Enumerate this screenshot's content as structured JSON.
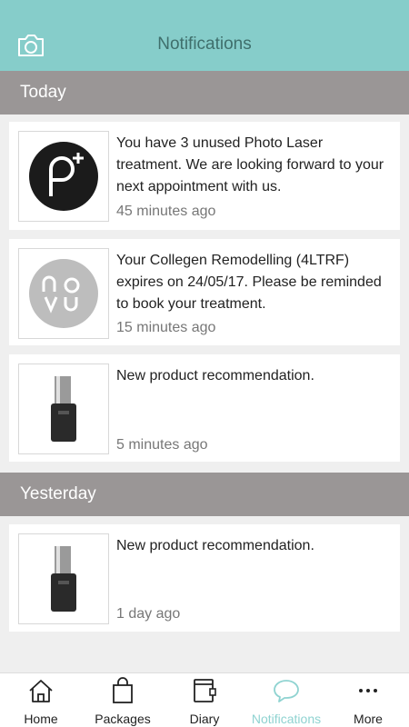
{
  "header": {
    "title": "Notifications",
    "camera_icon": "camera-icon"
  },
  "sections": [
    {
      "label": "Today"
    },
    {
      "label": "Yesterday"
    }
  ],
  "notifications": [
    {
      "thumbnail": "brand-logo-p-plus",
      "thumbnail_text": "p+",
      "message": "You have 3 unused Photo Laser treatment. We are looking forward to your next appointment with us.",
      "time": "45 minutes ago"
    },
    {
      "thumbnail": "brand-logo-novu",
      "thumbnail_text": "novu",
      "message": "Your Collegen Remodelling (4LTRF) expires on 24/05/17. Please be reminded to book your treatment.",
      "time": "15 minutes ago"
    },
    {
      "thumbnail": "product-bottle-image",
      "message": "New product recommendation.",
      "time": "5 minutes ago"
    },
    {
      "thumbnail": "product-bottle-image",
      "message": "New product recommendation.",
      "time": "1 day ago"
    }
  ],
  "tabbar": {
    "items": [
      {
        "label": "Home",
        "icon": "home-icon"
      },
      {
        "label": "Packages",
        "icon": "shopping-bag-icon"
      },
      {
        "label": "Diary",
        "icon": "diary-icon"
      },
      {
        "label": "Notifications",
        "icon": "speech-bubble-icon",
        "active": true
      },
      {
        "label": "More",
        "icon": "more-dots-icon"
      }
    ]
  },
  "colors": {
    "header_bg": "#86cdca",
    "section_bg": "#9a9696",
    "active_tab": "#8fd3d1"
  }
}
